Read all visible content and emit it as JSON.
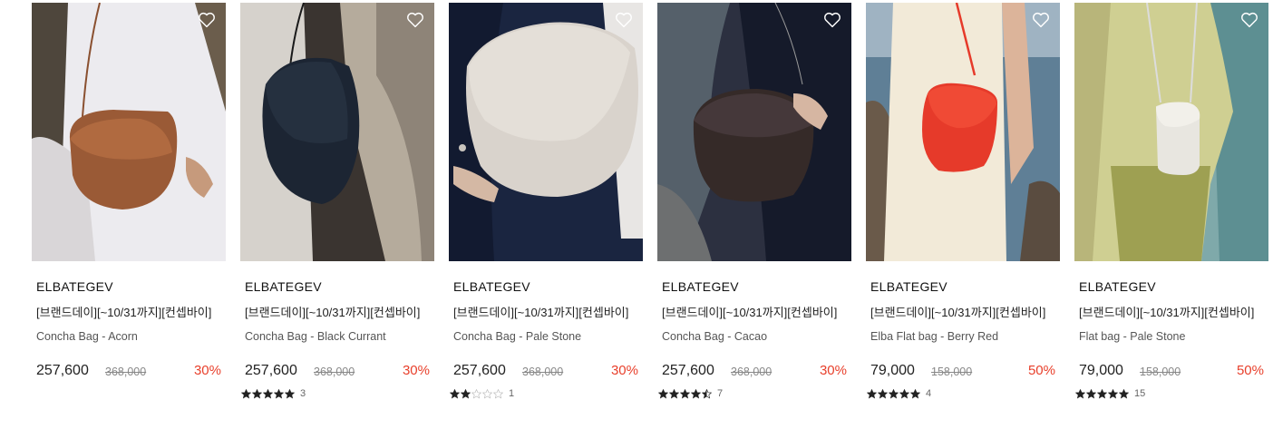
{
  "products": [
    {
      "brand": "ELBATEGEV",
      "title": "[브랜드데이][~10/31까지][컨셉바이]",
      "name": "Concha Bag - Acorn",
      "price": "257,600",
      "original": "368,000",
      "discount": "30%",
      "rating": null,
      "reviews": null,
      "bag_color": "#9a5a36",
      "bg": "#e6e4e6"
    },
    {
      "brand": "ELBATEGEV",
      "title": "[브랜드데이][~10/31까지][컨셉바이]",
      "name": "Concha Bag - Black Currant",
      "price": "257,600",
      "original": "368,000",
      "discount": "30%",
      "rating": 5,
      "reviews": "3",
      "bag_color": "#1f2a3a",
      "bg": "#b8b0a4"
    },
    {
      "brand": "ELBATEGEV",
      "title": "[브랜드데이][~10/31까지][컨셉바이]",
      "name": "Concha Bag - Pale Stone",
      "price": "257,600",
      "original": "368,000",
      "discount": "30%",
      "rating": 2,
      "reviews": "1",
      "bag_color": "#d9d3cc",
      "bg": "#1c2740"
    },
    {
      "brand": "ELBATEGEV",
      "title": "[브랜드데이][~10/31까지][컨셉바이]",
      "name": "Concha Bag - Cacao",
      "price": "257,600",
      "original": "368,000",
      "discount": "30%",
      "rating": 4.5,
      "reviews": "7",
      "bag_color": "#3a2e2c",
      "bg": "#1a2032"
    },
    {
      "brand": "ELBATEGEV",
      "title": "[브랜드데이][~10/31까지][컨셉바이]",
      "name": "Elba Flat bag - Berry Red",
      "price": "79,000",
      "original": "158,000",
      "discount": "50%",
      "rating": 5,
      "reviews": "4",
      "bag_color": "#e63a2a",
      "bg": "#6d8aa0"
    },
    {
      "brand": "ELBATEGEV",
      "title": "[브랜드데이][~10/31까지][컨셉바이]",
      "name": "Flat bag - Pale Stone",
      "price": "79,000",
      "original": "158,000",
      "discount": "50%",
      "rating": 5,
      "reviews": "15",
      "bag_color": "#e8e6e0",
      "bg": "#7da6a8"
    }
  ],
  "icons": {
    "wishlist": "heart-outline-icon",
    "star": "star-icon"
  }
}
